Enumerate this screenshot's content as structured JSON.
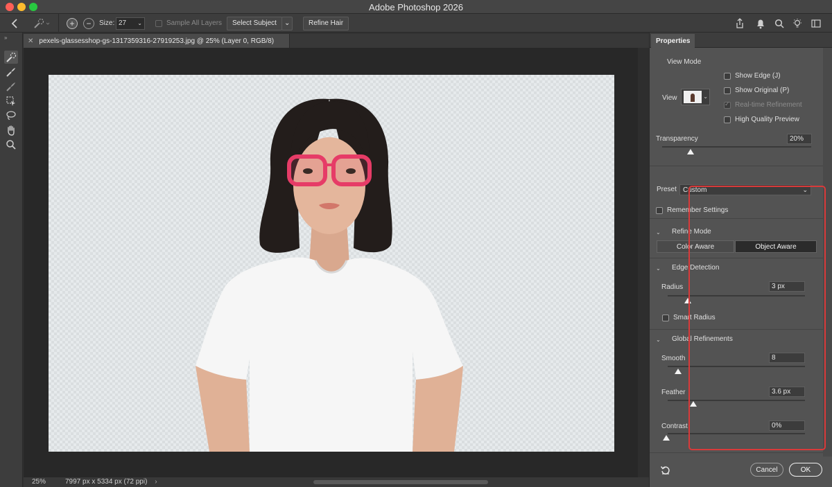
{
  "app": {
    "title": "Adobe Photoshop 2026"
  },
  "options_bar": {
    "size_label": "Size:",
    "size_value": "27",
    "sample_all_layers_label": "Sample All Layers",
    "select_subject_label": "Select Subject",
    "refine_hair_label": "Refine Hair"
  },
  "document": {
    "tab_title": "pexels-glassesshop-gs-1317359316-27919253.jpg @ 25% (Layer 0, RGB/8)",
    "zoom": "25%",
    "dimensions": "7997 px x 5334 px (72 ppi)"
  },
  "panel": {
    "tab_label": "Properties",
    "view_mode": {
      "heading": "View Mode",
      "view_label": "View",
      "show_edge_label": "Show Edge (J)",
      "show_original_label": "Show Original (P)",
      "realtime_label": "Real-time Refinement",
      "hq_preview_label": "High Quality Preview",
      "realtime_checked": true
    },
    "transparency": {
      "label": "Transparency",
      "value": "20%",
      "level": 0.2
    },
    "preset": {
      "label": "Preset",
      "value": "Custom"
    },
    "remember_settings_label": "Remember Settings",
    "refine_mode": {
      "heading": "Refine Mode",
      "color_aware_label": "Color Aware",
      "object_aware_label": "Object Aware",
      "selected": "Object Aware"
    },
    "edge_detection": {
      "heading": "Edge Detection",
      "radius_label": "Radius",
      "radius_value": "3 px",
      "smart_radius_label": "Smart Radius"
    },
    "global_refinements": {
      "heading": "Global Refinements",
      "smooth_label": "Smooth",
      "smooth_value": "8",
      "feather_label": "Feather",
      "feather_value": "3.6 px",
      "contrast_label": "Contrast",
      "contrast_value": "0%"
    },
    "cancel_label": "Cancel",
    "ok_label": "OK"
  },
  "icons": {
    "back": "chevron-left-icon",
    "brush": "quick-selection-brush-icon",
    "add": "add-to-selection-icon",
    "subtract": "subtract-from-selection-icon",
    "share": "share-icon",
    "bell": "bell-icon",
    "search": "search-icon",
    "bulb": "lightbulb-icon",
    "arrange": "arrange-documents-icon"
  },
  "colors": {
    "highlight_box": "#d93a3a",
    "panel_bg": "#535353",
    "app_bg": "#323232"
  }
}
